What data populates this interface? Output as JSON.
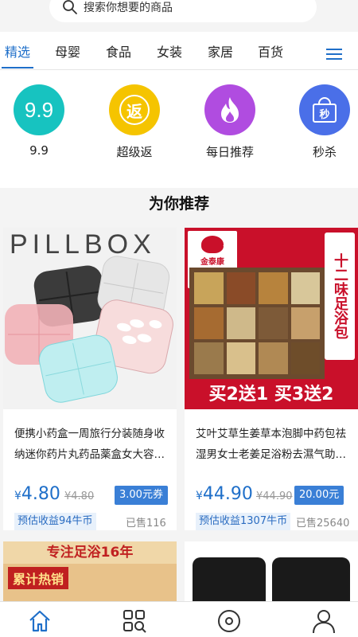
{
  "search": {
    "placeholder": "搜索你想要的商品"
  },
  "tabs": [
    {
      "label": "精选",
      "active": true
    },
    {
      "label": "母婴"
    },
    {
      "label": "食品"
    },
    {
      "label": "女装"
    },
    {
      "label": "家居"
    },
    {
      "label": "百货"
    }
  ],
  "categories": [
    {
      "label": "9.9",
      "icon_text": "9.9",
      "color": "#17c3c0"
    },
    {
      "label": "超级返",
      "icon_text": "返",
      "color": "#f5c400"
    },
    {
      "label": "每日推荐",
      "icon": "flame-icon",
      "color": "#b04ce0"
    },
    {
      "label": "秒杀",
      "icon_text": "秒",
      "color": "#4a6fe8"
    }
  ],
  "section_title": "为你推荐",
  "products": [
    {
      "image_text": "PILLBOX",
      "title": "便携小药盒一周旅行分装随身收纳迷你药片丸药品薬盒女大容…",
      "currency": "¥",
      "price": "4.80",
      "original_price": "¥4.80",
      "coupon": "3.00元券",
      "earn": "预估收益94牛币",
      "sold": "已售116"
    },
    {
      "image_text": "十二味足浴包",
      "image_badge": "买2送1 买3送2",
      "image_brand": "金泰康",
      "image_slogan": "专注足浴16年",
      "title": "艾叶艾草生姜草本泡脚中药包祛湿男女士老姜足浴粉去濕气助…",
      "currency": "¥",
      "price": "44.90",
      "original_price": "¥44.90",
      "coupon": "20.00元",
      "earn": "预估收益1307牛币",
      "sold": "已售25640"
    }
  ],
  "next_row": [
    {
      "banner_text": "专注足浴16年",
      "sub_text": "累计热销"
    },
    {
      "image": "black-jars"
    }
  ],
  "bottom_nav": [
    {
      "icon": "home-icon",
      "active": true
    },
    {
      "icon": "category-search-icon"
    },
    {
      "icon": "compass-icon"
    },
    {
      "icon": "user-icon"
    }
  ],
  "colors": {
    "accent": "#1f6fc9",
    "coupon": "#3a7fd6",
    "earn_bg": "#e8f1fb"
  }
}
